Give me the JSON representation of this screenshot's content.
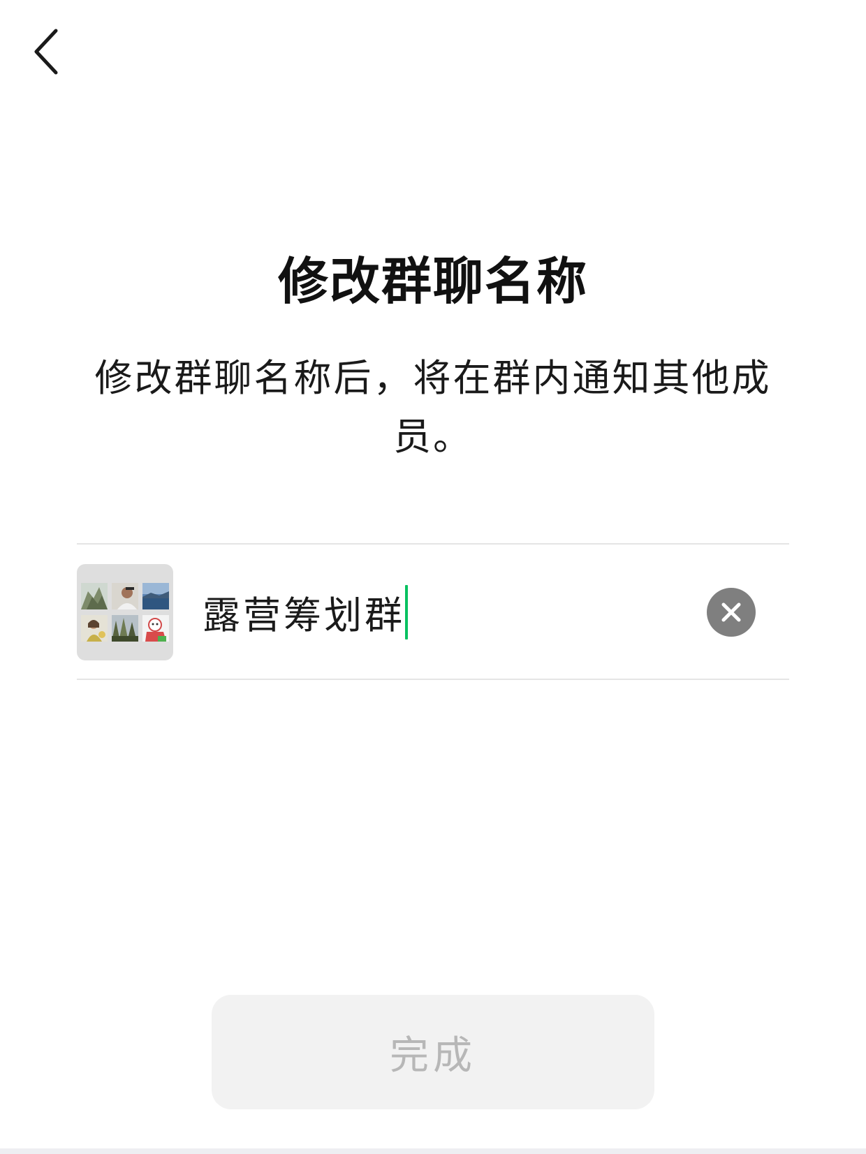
{
  "header": {
    "back_icon": "chevron-left-icon"
  },
  "main": {
    "title": "修改群聊名称",
    "description": "修改群聊名称后，将在群内通知其他成员。"
  },
  "group_name_field": {
    "value": "露营筹划群",
    "clear_icon": "close-icon",
    "cursor_color": "#07c160"
  },
  "group_avatar": {
    "members": [
      {
        "icon": "mountain-photo-avatar"
      },
      {
        "icon": "man-portrait-avatar"
      },
      {
        "icon": "lake-photo-avatar"
      },
      {
        "icon": "woman-photo-avatar"
      },
      {
        "icon": "forest-photo-avatar"
      },
      {
        "icon": "cartoon-pig-avatar"
      }
    ]
  },
  "footer": {
    "done_label": "完成"
  },
  "colors": {
    "accent": "#07c160",
    "disabled_button_bg": "#f2f2f2",
    "disabled_button_text": "#b7b7b7"
  }
}
